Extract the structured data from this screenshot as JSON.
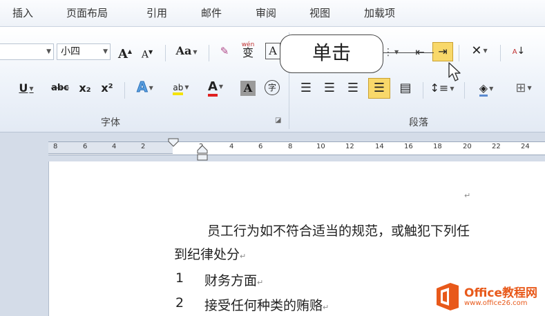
{
  "ribbon_tabs": [
    "插入",
    "页面布局",
    "引用",
    "邮件",
    "审阅",
    "视图",
    "加载项"
  ],
  "font_group": {
    "label": "字体",
    "font_size": "小四",
    "grow_font": "A",
    "shrink_font": "A",
    "change_case": "Aa",
    "phonetic": "wén",
    "phonetic_char": "变",
    "char_border": "A",
    "underline": "U",
    "strikethrough": "abc",
    "subscript": "x₂",
    "superscript": "x²",
    "text_effect": "A",
    "font_color": "A",
    "char_shading": "A",
    "enclose": "字"
  },
  "paragraph_group": {
    "label": "段落"
  },
  "callout": "单击",
  "ruler_numbers": [
    "8",
    "6",
    "4",
    "2",
    "2",
    "4",
    "6",
    "8",
    "10",
    "12",
    "14",
    "16",
    "18",
    "20",
    "22",
    "24"
  ],
  "document": {
    "line1": "员工行为如不符合适当的规范，或触犯下列任",
    "line2": "到纪律处分",
    "item1_num": "1",
    "item1_text": "财务方面",
    "item2_num": "2",
    "item2_text": "接受任何种类的贿赂"
  },
  "logo": {
    "brand": "Office教程网",
    "url": "www.office26.com"
  },
  "colors": {
    "accent_blue": "#2b5797",
    "highlight": "#f8d86a",
    "logo_orange": "#e8591a"
  }
}
